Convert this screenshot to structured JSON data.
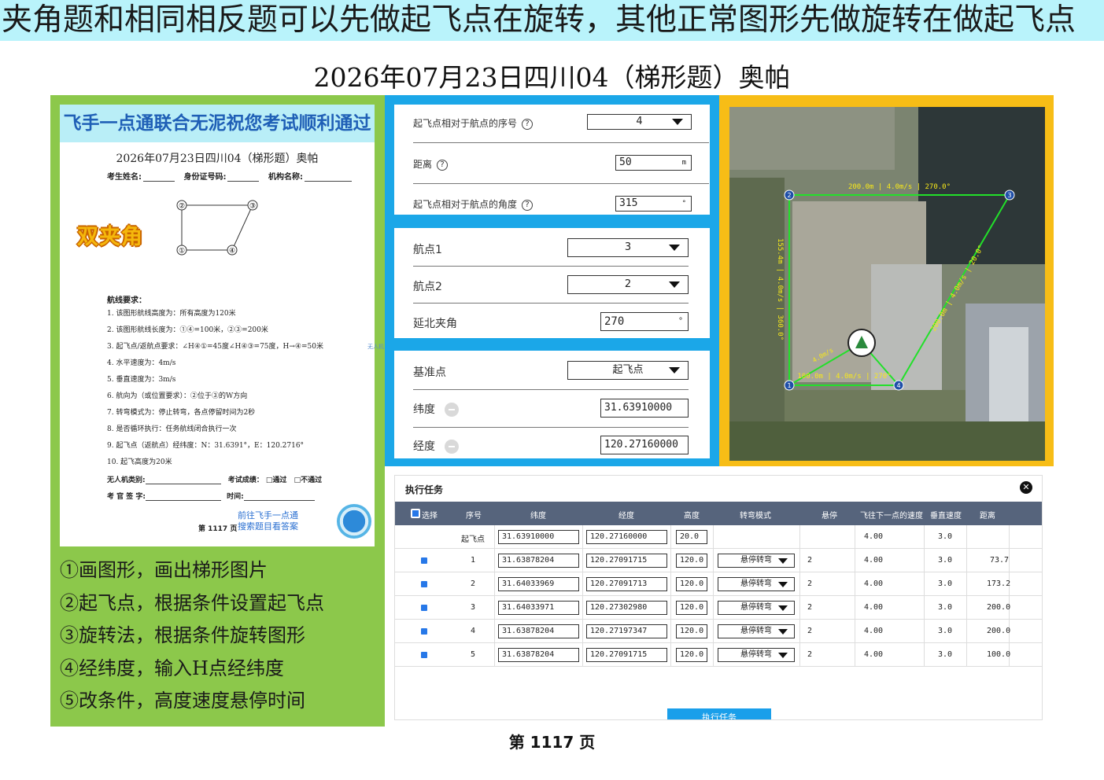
{
  "banner_text": "夹角题和相同相反题可以先做起飞点在旋转，其他正常图形先做旋转在做起飞点",
  "main_title": "2026年07月23日四川04（梯形题）奥帕",
  "doc": {
    "header": "飞手一点通联合无泥祝您考试顺利通过",
    "subtitle": "2026年07月23日四川04（梯形题）奥帕",
    "field_name": "考生姓名:",
    "field_id": "身份证号码:",
    "field_org": "机构名称:",
    "stamp": "双夹角",
    "point_labels": [
      "②",
      "③",
      "①",
      "④"
    ],
    "requirements_title": "航线要求：",
    "requirements": [
      "1.  该图形航线高度为：所有高度为120米",
      "2.  该图形航线长度为：①④=100米，②③=200米",
      "3.  起飞点/返航点要求：∠H④①=45度∠H④③=75度，H→④=50米",
      "4.  水平速度为：4m/s",
      "5.  垂直速度为：3m/s",
      "6.  航向为（或位置要求）：②位于③的W方向",
      "7.  转弯模式为：停止转弯，各点停留时间为2秒",
      "8.  是否循环执行：任务航线闭合执行一次",
      "9.  起飞点（返航点）经纬度：N：31.6391°，E：120.2716°",
      "10. 起飞高度为20米"
    ],
    "uav_type": "无人机类别:",
    "result": "考试成绩：",
    "pass": "□通过",
    "fail": "□不通过",
    "examiner": "考 官 签 字:",
    "time": "时间:",
    "link_line1": "前往飞手一点通",
    "link_line2": "搜索题目看答案",
    "page_label": "第 1117 页",
    "side_mark": "无人机"
  },
  "steps": [
    "①画图形，画出梯形图片",
    "②起飞点，根据条件设置起飞点",
    "③旋转法，根据条件旋转图形",
    "④经纬度，输入H点经纬度",
    "⑤改条件，高度速度悬停时间"
  ],
  "takeoff_form": {
    "seq_label": "起飞点相对于航点的序号",
    "seq_value": "4",
    "dist_label": "距离",
    "dist_value": "50",
    "dist_unit": "m",
    "angle_label": "起飞点相对于航点的角度",
    "angle_value": "315",
    "angle_unit": "°",
    "help_glyph": "?"
  },
  "rotate_form": {
    "wp1_label": "航点1",
    "wp1_value": "3",
    "wp2_label": "航点2",
    "wp2_value": "2",
    "north_label": "延北夹角",
    "north_value": "270",
    "north_unit": "°"
  },
  "coord_form": {
    "ref_label": "基准点",
    "ref_value": "起飞点",
    "lat_label": "纬度",
    "lat_value": "31.63910000",
    "lon_label": "经度",
    "lon_value": "120.27160000"
  },
  "map": {
    "labels": {
      "top": "200.0m | 4.0m/s | 270.0°",
      "left": "155.4m | 4.0m/s | 360.0°",
      "right": "200.0m | 4.0m/s | 20.0°",
      "bottom": "100.0m | 4.0m/s | 270°",
      "takeoff": "4.0m/s"
    },
    "point_labels": [
      "1",
      "2",
      "3",
      "4"
    ],
    "colors": {
      "route": "#22e02a",
      "waypoint": "#1f4fa8",
      "label": "#f7e81a"
    }
  },
  "task": {
    "title": "执行任务",
    "close_glyph": "✕",
    "columns": [
      "选择",
      "序号",
      "纬度",
      "经度",
      "高度",
      "转弯模式",
      "悬停",
      "飞往下一点的速度",
      "垂直速度",
      "距离"
    ],
    "takeoff_row": {
      "seq": "起飞点",
      "lat": "31.63910000",
      "lon": "120.27160000",
      "alt": "20.0",
      "speed": "4.00",
      "vspeed": "3.0"
    },
    "rows": [
      {
        "seq": "1",
        "lat": "31.63878204",
        "lon": "120.27091715",
        "alt": "120.0",
        "mode": "悬停转弯",
        "hover": "2",
        "speed": "4.00",
        "vspeed": "3.0",
        "dist": "73.7"
      },
      {
        "seq": "2",
        "lat": "31.64033969",
        "lon": "120.27091713",
        "alt": "120.0",
        "mode": "悬停转弯",
        "hover": "2",
        "speed": "4.00",
        "vspeed": "3.0",
        "dist": "173.2"
      },
      {
        "seq": "3",
        "lat": "31.64033971",
        "lon": "120.27302980",
        "alt": "120.0",
        "mode": "悬停转弯",
        "hover": "2",
        "speed": "4.00",
        "vspeed": "3.0",
        "dist": "200.0"
      },
      {
        "seq": "4",
        "lat": "31.63878204",
        "lon": "120.27197347",
        "alt": "120.0",
        "mode": "悬停转弯",
        "hover": "2",
        "speed": "4.00",
        "vspeed": "3.0",
        "dist": "200.0"
      },
      {
        "seq": "5",
        "lat": "31.63878204",
        "lon": "120.27091715",
        "alt": "120.0",
        "mode": "悬停转弯",
        "hover": "2",
        "speed": "4.00",
        "vspeed": "3.0",
        "dist": "100.0"
      }
    ],
    "exec_button": "执行任务"
  },
  "footer": "第 1117 页"
}
